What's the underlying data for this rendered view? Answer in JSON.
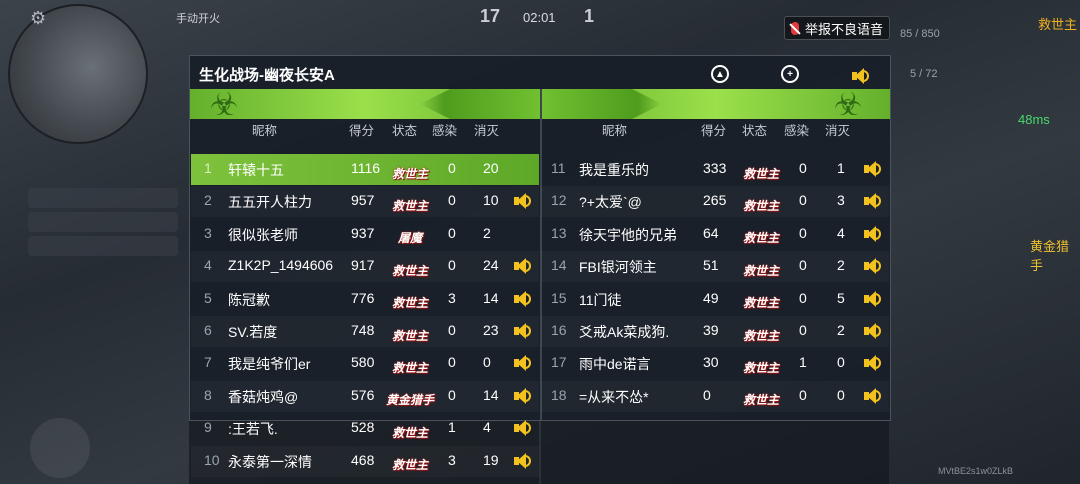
{
  "hud": {
    "mode_toggle": "手动开火",
    "score_left": "17",
    "timer": "02:01",
    "score_right": "1",
    "report_label": "举报不良语音",
    "ping": "48ms",
    "ammo_top": "85 / 850",
    "ammo_low": "5 / 72",
    "side_label_1": "救世主",
    "side_label_2": "黄金猎手",
    "watermark": "MVtBE2s1w0ZLkB"
  },
  "panel": {
    "title": "生化战场-幽夜长安A",
    "columns": {
      "name": "昵称",
      "score": "得分",
      "status": "状态",
      "infect": "感染",
      "kill": "消灭"
    }
  },
  "left_players": [
    {
      "rank": "1",
      "name": "轩辕十五",
      "score": "1116",
      "status": "救世主",
      "infect": "0",
      "kill": "20",
      "voice": false,
      "highlight": true
    },
    {
      "rank": "2",
      "name": "五五开人柱力",
      "score": "957",
      "status": "救世主",
      "infect": "0",
      "kill": "10",
      "voice": true
    },
    {
      "rank": "3",
      "name": "很似张老师",
      "score": "937",
      "status": "屠魔",
      "infect": "0",
      "kill": "2",
      "voice": false
    },
    {
      "rank": "4",
      "name": "Z1K2P_1494606",
      "score": "917",
      "status": "救世主",
      "infect": "0",
      "kill": "24",
      "voice": true
    },
    {
      "rank": "5",
      "name": "陈冠歉",
      "score": "776",
      "status": "救世主",
      "infect": "3",
      "kill": "14",
      "voice": true
    },
    {
      "rank": "6",
      "name": "SV.若度",
      "score": "748",
      "status": "救世主",
      "infect": "0",
      "kill": "23",
      "voice": true
    },
    {
      "rank": "7",
      "name": "我是纯爷们er",
      "score": "580",
      "status": "救世主",
      "infect": "0",
      "kill": "0",
      "voice": true
    },
    {
      "rank": "8",
      "name": "香菇炖鸡@",
      "score": "576",
      "status": "黄金猎手",
      "infect": "0",
      "kill": "14",
      "voice": true
    },
    {
      "rank": "9",
      "name": ":王若飞.",
      "score": "528",
      "status": "救世主",
      "infect": "1",
      "kill": "4",
      "voice": true
    },
    {
      "rank": "10",
      "name": "永泰第一深情",
      "score": "468",
      "status": "救世主",
      "infect": "3",
      "kill": "19",
      "voice": true
    }
  ],
  "right_players": [
    {
      "rank": "11",
      "name": "我是重乐的",
      "score": "333",
      "status": "救世主",
      "infect": "0",
      "kill": "1",
      "voice": true
    },
    {
      "rank": "12",
      "name": "?+太爱`@",
      "score": "265",
      "status": "救世主",
      "infect": "0",
      "kill": "3",
      "voice": true
    },
    {
      "rank": "13",
      "name": "徐天宇他的兄弟",
      "score": "64",
      "status": "救世主",
      "infect": "0",
      "kill": "4",
      "voice": true
    },
    {
      "rank": "14",
      "name": "FBI银河领主",
      "score": "51",
      "status": "救世主",
      "infect": "0",
      "kill": "2",
      "voice": true
    },
    {
      "rank": "15",
      "name": "11门徒",
      "score": "49",
      "status": "救世主",
      "infect": "0",
      "kill": "5",
      "voice": true
    },
    {
      "rank": "16",
      "name": "爻戒Ak菜成狗.",
      "score": "39",
      "status": "救世主",
      "infect": "0",
      "kill": "2",
      "voice": true
    },
    {
      "rank": "17",
      "name": "雨中de诺言",
      "score": "30",
      "status": "救世主",
      "infect": "1",
      "kill": "0",
      "voice": true
    },
    {
      "rank": "18",
      "name": "=从来不怂*",
      "score": "0",
      "status": "救世主",
      "infect": "0",
      "kill": "0",
      "voice": true
    }
  ],
  "colors": {
    "banner": "#7fc63a",
    "highlight": "#6cb530",
    "speaker": "#f4c21f",
    "panel": "#181e28"
  }
}
